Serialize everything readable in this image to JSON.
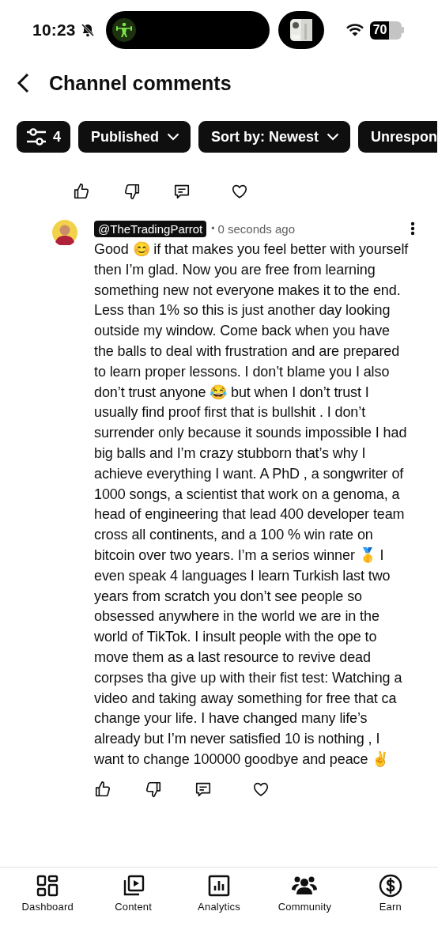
{
  "status_bar": {
    "time": "10:23",
    "battery": "70"
  },
  "header": {
    "title": "Channel comments"
  },
  "filters": [
    {
      "kind": "filter",
      "label": "4"
    },
    {
      "kind": "dropdown",
      "label": "Published"
    },
    {
      "kind": "dropdown",
      "label": "Sort by: Newest"
    },
    {
      "kind": "dropdown",
      "label": "Unrespon"
    }
  ],
  "comment": {
    "author": "@TheTradingParrot",
    "separator": "•",
    "time": "0 seconds ago",
    "text": "Good 😊 if that makes you feel better with yourself then I’m glad. Now you are free from learning something new not everyone makes it to the end. Less than 1% so this is just another day looking outside my window. Come back when you have the balls to deal with frustration and are prepared to learn proper lessons. I don’t blame you I also don’t trust anyone 😂 but when I don’t trust I usually find proof first that is bullshit . I don’t surrender only because it sounds impossible I had big balls and I’m crazy stubborn that’s why I achieve everything I want. A PhD , a songwriter of 1000 songs, a scientist that work on a genoma, a head of engineering that lead 400 developer team cross all continents, and a 100 % win rate on bitcoin over two years. I’m a serios winner 🥇 I even speak 4 languages I learn Turkish last two years from scratch you don’t see people so obsessed anywhere in the world we are in the world of TikTok. I insult people with the ope to move them as a last resource to revive dead corpses tha give up with their fist test: Watching a video and taking away something for free that ca change your life. I have changed many life’s already but I’m never satisfied 10 is nothing , I want to change 100000 goodbye and peace ✌️"
  },
  "nav": [
    {
      "kind": "dashboard",
      "label": "Dashboard"
    },
    {
      "kind": "content",
      "label": "Content"
    },
    {
      "kind": "analytics",
      "label": "Analytics"
    },
    {
      "kind": "community",
      "label": "Community"
    },
    {
      "kind": "earn",
      "label": "Earn"
    }
  ]
}
